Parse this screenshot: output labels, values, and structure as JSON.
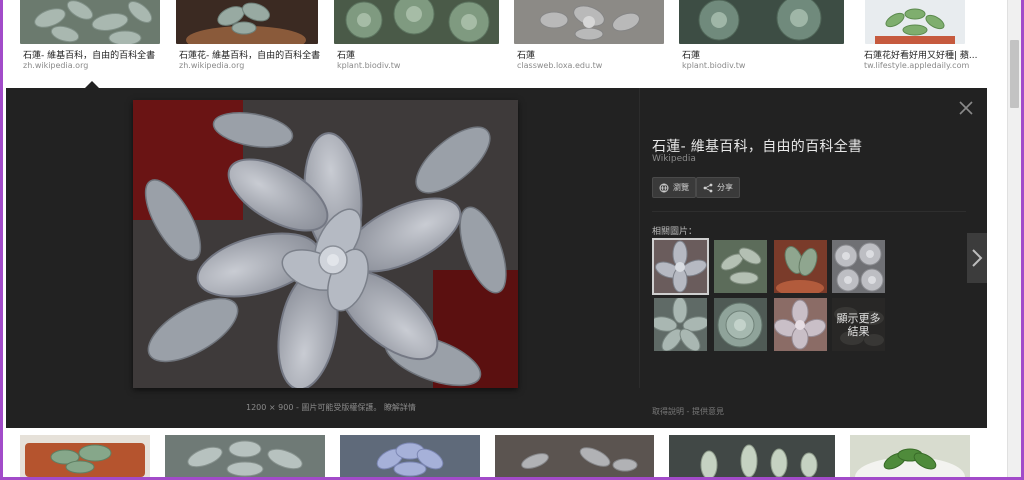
{
  "top_results": [
    {
      "caption": "石蓮- 維基百科，自由的百科全書",
      "source": "zh.wikipedia.org"
    },
    {
      "caption": "石蓮花- 維基百科，自由的百科全書",
      "source": "zh.wikipedia.org"
    },
    {
      "caption": "石蓮",
      "source": "kplant.biodiv.tw"
    },
    {
      "caption": "石蓮",
      "source": "classweb.loxa.edu.tw"
    },
    {
      "caption": "石蓮",
      "source": "kplant.biodiv.tw"
    },
    {
      "caption": "石蓮花好看好用又好種| 蘋...",
      "source": "tw.lifestyle.appledaily.com"
    }
  ],
  "viewer": {
    "title": "石蓮- 維基百科，自由的百科全書",
    "source": "Wikipedia",
    "visit_label": "瀏覽",
    "share_label": "分享",
    "related_label": "相關圖片：",
    "more_results_label": "顯示更多結果",
    "image_meta": "1200 × 900 - 圖片可能受版權保護。",
    "learn_more": "瞭解詳情",
    "footer_help": "取得說明",
    "footer_feedback": "提供意見"
  },
  "icons": {
    "close": "close-icon",
    "visit": "globe-icon",
    "share": "share-icon",
    "next": "chevron-right-icon"
  },
  "colors": {
    "panel_bg": "#222222",
    "frame_border": "#a24bc9",
    "accent_text": "#e8e8e8"
  }
}
